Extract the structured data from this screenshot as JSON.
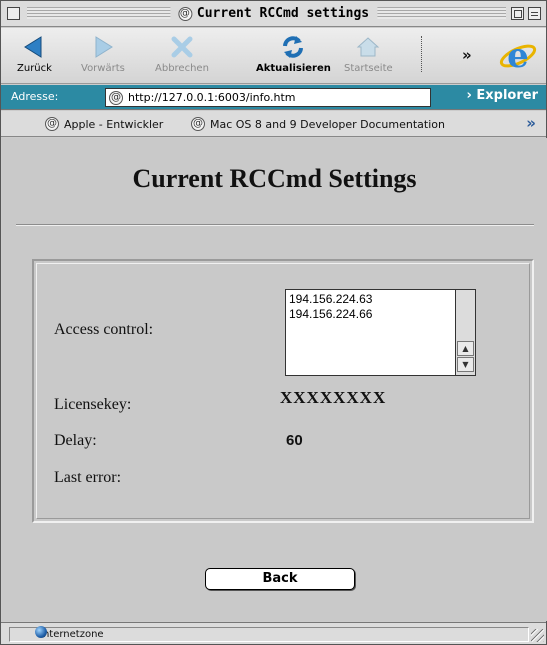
{
  "window": {
    "title": "Current RCCmd settings"
  },
  "toolbar": {
    "back": "Zurück",
    "forward": "Vorwärts",
    "stop": "Abbrechen",
    "refresh": "Aktualisieren",
    "home": "Startseite",
    "more": "»"
  },
  "address": {
    "label": "Adresse:",
    "url": "http://127.0.0.1:6003/info.htm",
    "explorer": "› Explorer"
  },
  "favorites": {
    "items": [
      "Apple - Entwickler",
      "Mac OS 8 and 9 Developer Documentation"
    ],
    "more": "»"
  },
  "page": {
    "heading": "Current RCCmd Settings",
    "access_label": "Access control:",
    "access_list": [
      "194.156.224.63",
      "194.156.224.66"
    ],
    "license_label": "Licensekey:",
    "license_value": "XXXXXXXX",
    "delay_label": "Delay:",
    "delay_value": "60",
    "error_label": "Last error:",
    "error_value": "",
    "back_button": "Back"
  },
  "status": {
    "zone": "Internetzone"
  },
  "colors": {
    "address_bar": "#2c8aa3",
    "content_bg": "#c9c9c9"
  }
}
